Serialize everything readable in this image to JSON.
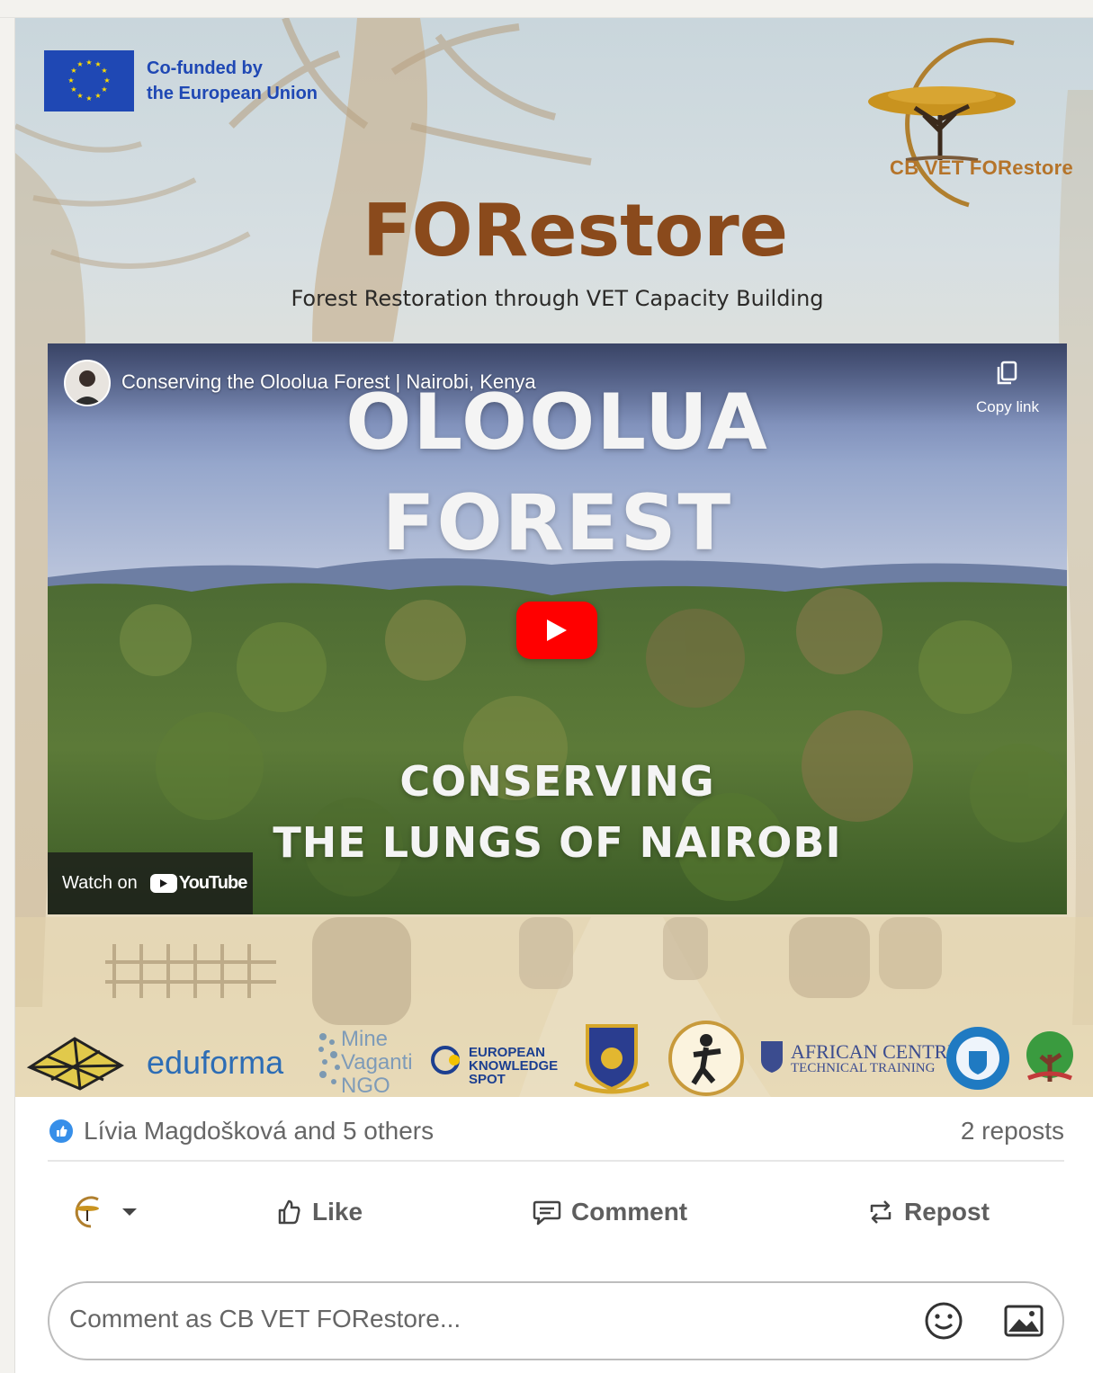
{
  "banner": {
    "eu_label_line1": "Co-funded by",
    "eu_label_line2": "the European Union",
    "logo_text": "CB VET FORestore",
    "title": "FORestore",
    "subtitle": "Forest Restoration through VET Capacity Building"
  },
  "video": {
    "caption": "Conserving the Oloolua Forest | Nairobi, Kenya",
    "copy_link_label": "Copy link",
    "overlay_line1": "OLOOLUA",
    "overlay_line2": "FOREST",
    "overlay_line3": "CONSERVING",
    "overlay_line4": "THE LUNGS OF NAIROBI",
    "watch_on_label": "Watch on",
    "youtube_label": "YouTube"
  },
  "partners": {
    "eduforma": "eduforma",
    "mine_line1": "Mine",
    "mine_line2": "Vaganti",
    "mine_line3": "NGO",
    "eks_line1": "EUROPEAN",
    "eks_line2": "KNOWLEDGE",
    "eks_line3": "SPOT",
    "african_line1": "AFRICAN CENTRE",
    "african_line2": "TECHNICAL TRAINING"
  },
  "social": {
    "reactions_text": "Lívia Magdošková and 5 others",
    "reposts_text": "2 reposts"
  },
  "actions": {
    "like_label": "Like",
    "comment_label": "Comment",
    "repost_label": "Repost"
  },
  "comment": {
    "placeholder": "Comment as CB VET FORestore..."
  },
  "colors": {
    "eu_blue": "#1f48b4",
    "brand_brown": "#8a4a1c",
    "youtube_red": "#ff0000",
    "like_blue": "#378fe9"
  },
  "icons": [
    "eu-flag-icon",
    "copy-link-icon",
    "play-icon",
    "youtube-icon",
    "like-reaction-icon",
    "like-icon",
    "comment-icon",
    "repost-icon",
    "chevron-down-icon",
    "emoji-icon",
    "image-icon"
  ]
}
